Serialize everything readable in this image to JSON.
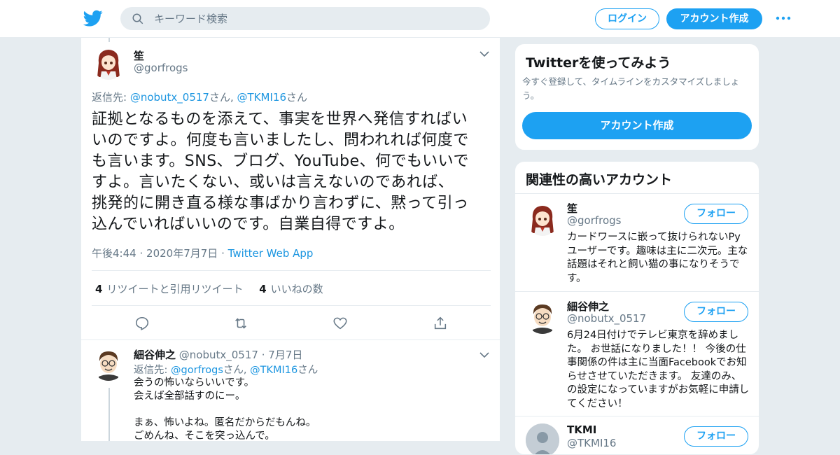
{
  "header": {
    "search_placeholder": "キーワード検索",
    "login_label": "ログイン",
    "signup_label": "アカウント作成"
  },
  "tweet": {
    "name": "笙",
    "handle": "@gorfrogs",
    "reply_prefix": "返信先: ",
    "reply_to_1": "@nobutx_0517",
    "reply_mid": "さん, ",
    "reply_to_2": "@TKMI16",
    "reply_suffix": "さん",
    "text_lines": [
      "証拠となるものを添えて、事実を世界へ発信すればい",
      "いのですよ。何度も言いましたし、問われれば何度で",
      "も言います。SNS、ブログ、YouTube、何でもいいで",
      "すよ。言いたくない、或いは言えないのであれば、",
      "挑発的に開き直る様な事ばかり言わずに、黙って引っ",
      "込んでいればいいのです。自業自得ですよ。"
    ],
    "time": "午後4:44",
    "date": "2020年7月7日",
    "dot": "·",
    "source": "Twitter Web App",
    "retweet_count": "4",
    "retweet_label": "リツイートと引用リツイート",
    "like_count": "4",
    "like_label": "いいねの数"
  },
  "reply": {
    "name": "細谷伸之",
    "handle": "@nobutx_0517",
    "dot": "·",
    "date": "7月7日",
    "reply_prefix": "返信先: ",
    "reply_to_1": "@gorfrogs",
    "reply_mid": "さん, ",
    "reply_to_2": "@TKMI16",
    "reply_suffix": "さん",
    "body": "会うの怖いならいいです。\n会えば全部話すのにー。\n\nまぁ、怖いよね。匿名だからだもんね。\nごめんね、そこを突っ込んで。"
  },
  "signup_card": {
    "title": "Twitterを使ってみよう",
    "subtitle": "今すぐ登録して、タイムラインをカスタマイズしましょう。",
    "button": "アカウント作成"
  },
  "related": {
    "title": "関連性の高いアカウント",
    "follow_label": "フォロー",
    "accounts": [
      {
        "name": "笙",
        "handle": "@gorfrogs",
        "bio": "カードワースに嵌って抜けられないPyユーザーです。趣味は主に二次元。主な話題はそれと飼い猫の事になりそうです。"
      },
      {
        "name": "細谷伸之",
        "handle": "@nobutx_0517",
        "bio": "6月24日付けでテレビ東京を辞めました。 お世話になりました！！ 今後の仕事関係の件は主に当面Facebookでお知らせさせていただきます。 友達のみ、の設定になっていますがお気軽に申請してください！"
      },
      {
        "name": "TKMI",
        "handle": "@TKMI16",
        "bio": ""
      }
    ]
  },
  "colors": {
    "accent": "#1da1f2",
    "link": "#1b95e0",
    "muted": "#657786",
    "bg": "#e6ecf0"
  }
}
